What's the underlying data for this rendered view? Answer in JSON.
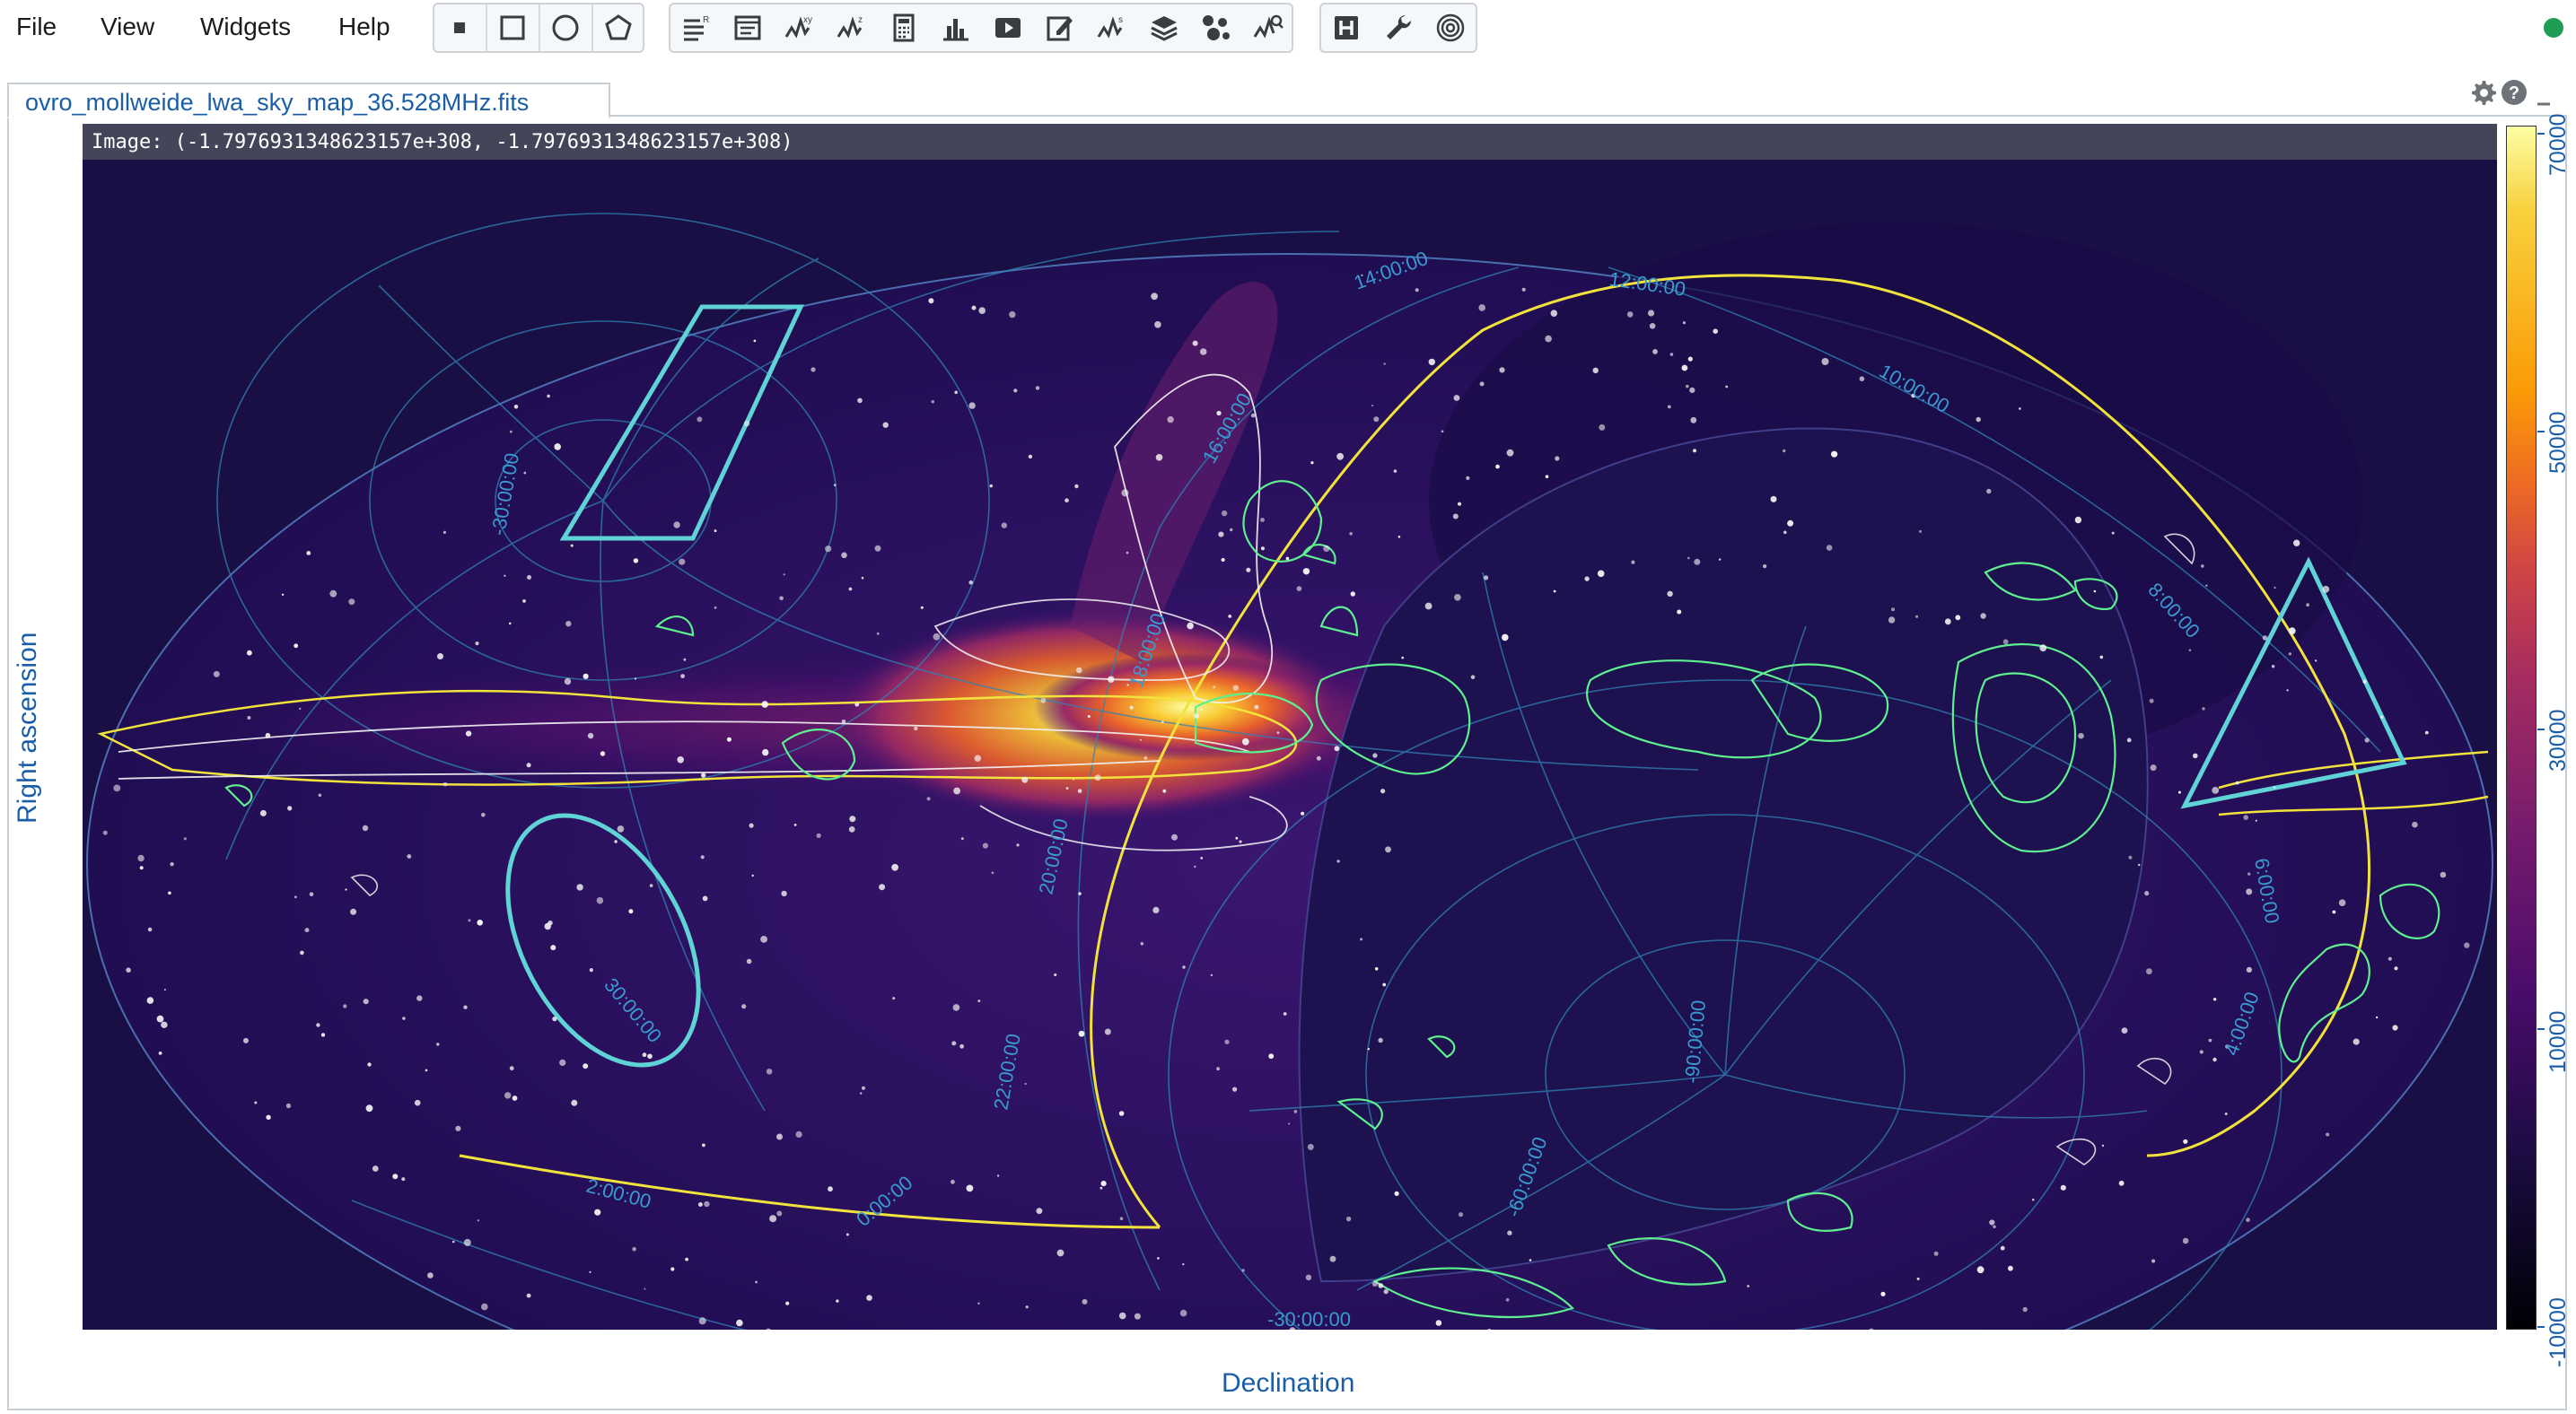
{
  "menu": {
    "file": "File",
    "view": "View",
    "widgets": "Widgets",
    "help": "Help"
  },
  "toolbar": {
    "region_tools": [
      "point-region-tool",
      "rectangle-region-tool",
      "ellipse-region-tool",
      "polygon-region-tool"
    ],
    "widget_tools": [
      "region-list-icon",
      "file-header-icon",
      "spatial-profiler-icon",
      "spectral-profiler-icon",
      "statistics-icon",
      "histogram-icon",
      "animator-icon",
      "render-config-icon",
      "stokes-analysis-icon",
      "image-list-icon",
      "catalog-icon",
      "spectral-line-query-icon"
    ],
    "extra_tools": [
      "hips-icon",
      "settings-wrench-icon",
      "contour-icon"
    ]
  },
  "status": {
    "color": "#1f9d55"
  },
  "tab": {
    "title": "ovro_mollweide_lwa_sky_map_36.528MHz.fits"
  },
  "cursor_info": {
    "text": "Image: (-1.7976931348623157e+308, -1.7976931348623157e+308)"
  },
  "colorbar": {
    "labels": [
      "70000",
      "50000",
      "30000",
      "10000",
      "-10000"
    ],
    "colormap": "inferno"
  },
  "axes": {
    "ylabel": "Right ascension",
    "xlabel": "Declination"
  },
  "grid_labels": [
    "14:00:00",
    "12:00:00",
    "16:00:00",
    "10:00:00",
    "18:00:00",
    "8:00:00",
    "6:00:00",
    "20:00:00",
    "22:00:00",
    "4:00:00",
    "2:00:00",
    "0:00:00",
    "30:00:00",
    "-30:00:00",
    "-60:00:00",
    "-90:00:00",
    "-30:00:00"
  ],
  "colors": {
    "accent": "#1a5ea8",
    "grid": "#2f83b5",
    "grid_label": "#3a9ad0",
    "contour_green": "#5ef08f",
    "contour_yellow": "#f2e33c",
    "contour_white": "#f4f4f4",
    "region": "#5fd3d6",
    "background": "#190f44"
  }
}
